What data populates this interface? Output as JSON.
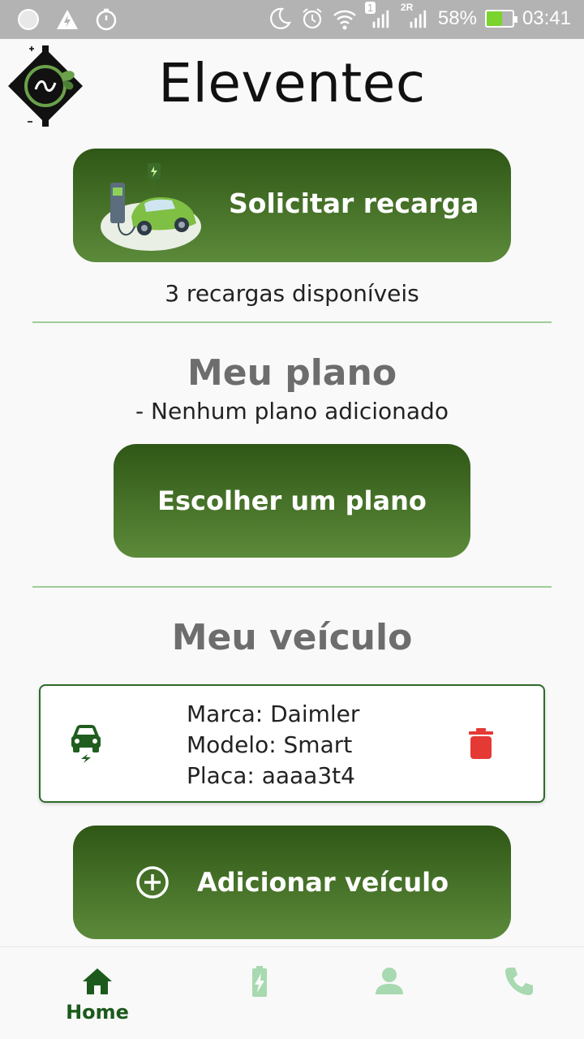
{
  "status_bar": {
    "battery": "58%",
    "time": "03:41",
    "sim_badge": "1",
    "roaming": "2R",
    "battery_level": 0.58
  },
  "header": {
    "title": "Eleventec",
    "logo_icon": "eleventec-logo"
  },
  "recharge": {
    "button_label": "Solicitar recarga",
    "available_text": "3 recargas disponíveis"
  },
  "plan": {
    "title": "Meu plano",
    "status": "- Nenhum plano adicionado",
    "choose_button": "Escolher um plano"
  },
  "vehicle": {
    "title": "Meu veículo",
    "brand": "Marca: Daimler",
    "model": "Modelo: Smart",
    "plate": "Placa: aaaa3t4",
    "add_button": "Adicionar veículo"
  },
  "bottom_nav": {
    "items": [
      {
        "label": "Home",
        "icon": "home-icon",
        "active": true
      },
      {
        "label": "",
        "icon": "battery-charging-icon",
        "active": false
      },
      {
        "label": "",
        "icon": "person-icon",
        "active": false
      },
      {
        "label": "",
        "icon": "phone-icon",
        "active": false
      }
    ]
  },
  "colors": {
    "accent_dark": "#2f5716",
    "accent_light": "#5c8a3a",
    "nav_active": "#1c5a1c",
    "nav_inactive": "#a8d9b0",
    "delete": "#e53935",
    "divider": "#9fcc98"
  }
}
